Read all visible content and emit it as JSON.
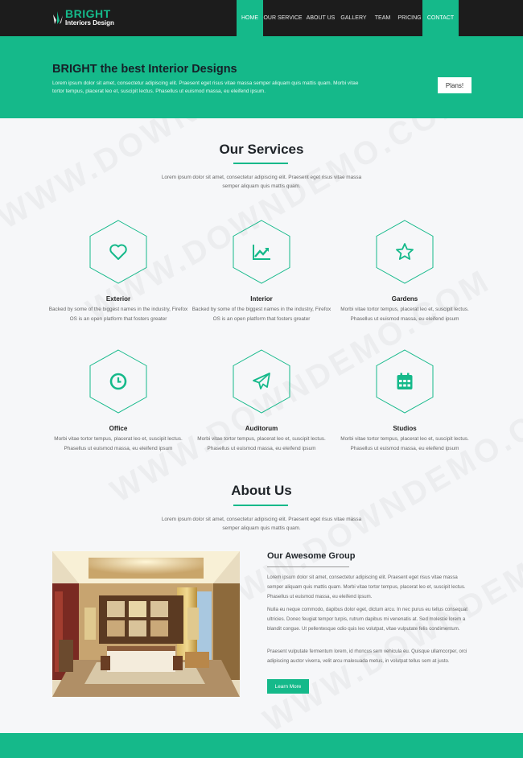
{
  "brand": {
    "title": "BRIGHT",
    "subtitle": "Interiors Design"
  },
  "nav": {
    "items": [
      {
        "label": "HOME",
        "active": true
      },
      {
        "label": "OUR SERVICE",
        "active": false
      },
      {
        "label": "ABOUT US",
        "active": false
      },
      {
        "label": "GALLERY",
        "active": false
      },
      {
        "label": "TEAM",
        "active": false
      },
      {
        "label": "PRICING",
        "active": false
      },
      {
        "label": "CONTACT",
        "active": true
      }
    ]
  },
  "hero": {
    "title": "BRIGHT the best Interior Designs",
    "text": "Lorem ipsum dolor sit amet, consectetur adipiscing elit. Praesent eget risus vitae massa semper aliquam quis mattis quam. Morbi vitae tortor tempus, placerat leo et, suscipit lectus. Phasellus ut euismod massa, eu eleifend ipsum.",
    "button_label": "Plans!"
  },
  "services": {
    "title": "Our Services",
    "intro": "Lorem ipsum dolor sit amet, consectetur adipiscing elit. Praesent eget risus vitae massa semper aliquam quis mattis quam.",
    "items": [
      {
        "title": "Exterior",
        "icon": "heart-icon",
        "desc": "Backed by some of the biggest names in the industry, Firefox OS is an open platform that fosters greater"
      },
      {
        "title": "Interior",
        "icon": "chart-line-icon",
        "desc": "Backed by some of the biggest names in the industry, Firefox OS is an open platform that fosters greater"
      },
      {
        "title": "Gardens",
        "icon": "star-icon",
        "desc": "Morbi vitae tortor tempus, placerat leo et, suscipit lectus. Phasellus ut euismod massa, eu eleifend ipsum"
      },
      {
        "title": "Office",
        "icon": "clock-icon",
        "desc": "Morbi vitae tortor tempus, placerat leo et, suscipit lectus. Phasellus ut euismod massa, eu eleifend ipsum"
      },
      {
        "title": "Auditorum",
        "icon": "paper-plane-icon",
        "desc": "Morbi vitae tortor tempus, placerat leo et, suscipit lectus. Phasellus ut euismod massa, eu eleifend ipsum"
      },
      {
        "title": "Studios",
        "icon": "calendar-icon",
        "desc": "Morbi vitae tortor tempus, placerat leo et, suscipit lectus. Phasellus ut euismod massa, eu eleifend ipsum"
      }
    ]
  },
  "about": {
    "title": "About Us",
    "intro": "Lorem ipsum dolor sit amet, consectetur adipiscing elit. Praesent eget risus vitae massa semper aliquam quis mattis quam.",
    "heading": "Our Awesome Group",
    "paragraphs": [
      "Lorem ipsum dolor sit amet, consectetur adipiscing elit. Praesent eget risus vitae massa semper aliquam quis mattis quam. Morbi vitae tortor tempus, placerat leo et, suscipit lectus. Phasellus ut euismod massa, eu eleifend ipsum.",
      "Nulla eu neque commodo, dapibus dolor eget, dictum arcu. In nec purus eu tellus consequat ultricies. Donec feugiat tempor turpis, rutrum dapibus mi venenatis at. Sed molestie lorem a blandit congue. Ut pellentesque odio quis leo volutpat, vitae vulputate felis condimentum.",
      "Praesent vulputate fermentum lorem, id rhoncus sem vehicula eu. Quisque ullamcorper, orci adipiscing auctor viverra, velit arcu malesuada metus, in volutpat tellus sem at justo."
    ],
    "button_label": "Learn More"
  },
  "watermark": "WWW.DOWNDEMO.COM",
  "colors": {
    "accent": "#15b98a",
    "navbar": "#1c1c1c",
    "background": "#f6f7f9"
  }
}
